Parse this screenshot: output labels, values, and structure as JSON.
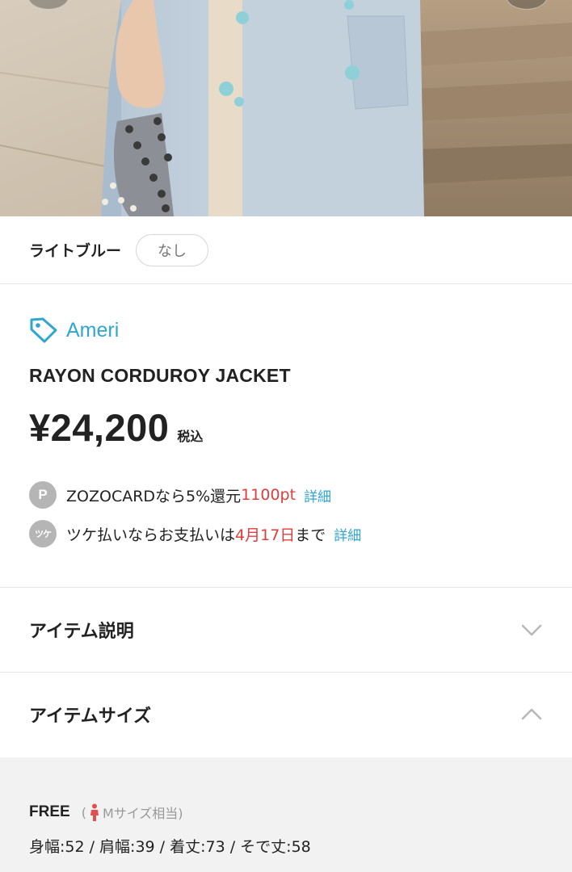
{
  "color_row": {
    "color_name": "ライトブルー",
    "stock_status": "なし"
  },
  "product": {
    "brand": "Ameri",
    "title": "RAYON CORDUROY JACKET",
    "price": "¥24,200",
    "tax_label": "税込"
  },
  "perks": [
    {
      "icon_text": "P",
      "text_before": "ZOZOCARDなら5%還元",
      "highlight": "1100pt",
      "text_after": "",
      "link": "詳細"
    },
    {
      "icon_text": "ツケ",
      "text_before": "ツケ払いならお支払いは",
      "highlight": "4月17日",
      "text_after": "まで",
      "link": "詳細"
    }
  ],
  "accordions": {
    "description_label": "アイテム説明",
    "size_label": "アイテムサイズ"
  },
  "size": {
    "name": "FREE",
    "note_open": "(",
    "note_text": "Mサイズ相当)",
    "measurements": "身幅:52 / 肩幅:39 / 着丈:73 / そで丈:58"
  },
  "colors": {
    "accent": "#2fa6d1",
    "highlight_red": "#e03c3c",
    "panel_bg": "#f2f2f2",
    "icon_gray": "#b5b5b5"
  },
  "icons": {
    "brand": "tag-icon",
    "description_toggle": "chevron-down-icon",
    "size_toggle": "chevron-up-icon",
    "size_figure": "person-icon"
  }
}
